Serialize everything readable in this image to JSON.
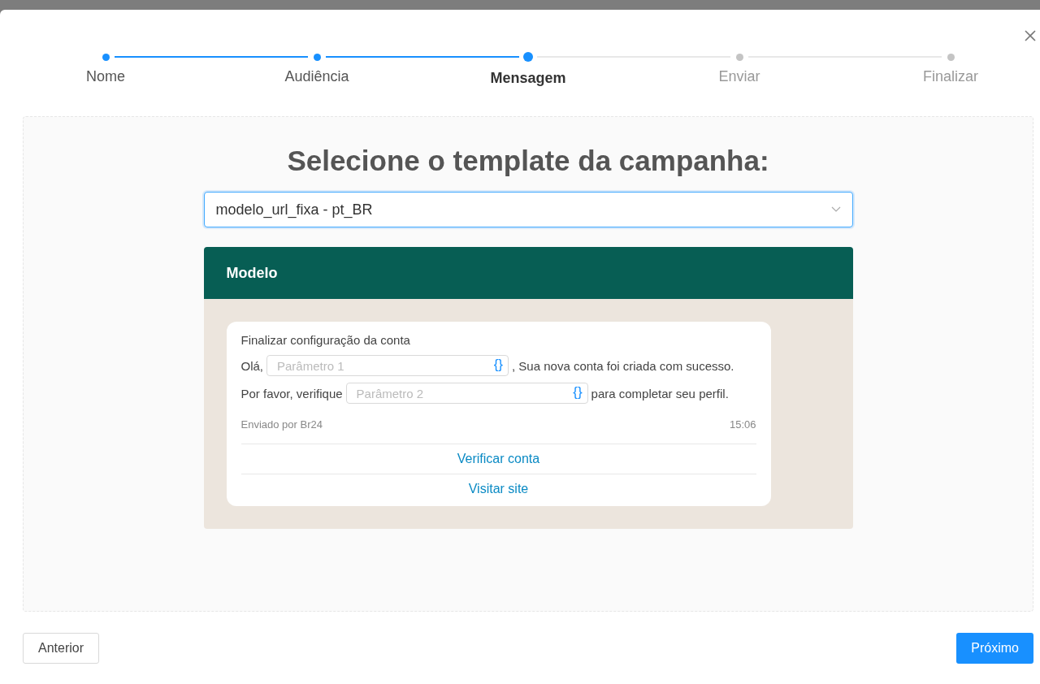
{
  "steps": [
    {
      "label": "Nome",
      "completed": true,
      "selected": false
    },
    {
      "label": "Audiência",
      "completed": true,
      "selected": false
    },
    {
      "label": "Mensagem",
      "completed": false,
      "selected": true
    },
    {
      "label": "Enviar",
      "completed": false,
      "selected": false
    },
    {
      "label": "Finalizar",
      "completed": false,
      "selected": false
    }
  ],
  "title": "Selecione o template da campanha:",
  "template_select": {
    "value": "modelo_url_fixa - pt_BR"
  },
  "preview": {
    "header": "Modelo",
    "message_title": "Finalizar configuração da conta",
    "lines": [
      [
        {
          "kind": "text",
          "text": "Olá,"
        },
        {
          "kind": "param",
          "placeholder": "Parâmetro 1",
          "icon": "{}"
        },
        {
          "kind": "text",
          "text": ", Sua nova conta foi criada com sucesso."
        }
      ],
      [
        {
          "kind": "text",
          "text": "Por favor, verifique"
        },
        {
          "kind": "param",
          "placeholder": "Parâmetro 2",
          "icon": "{}"
        },
        {
          "kind": "text",
          "text": "para completar seu perfil."
        }
      ]
    ],
    "sender": "Enviado por Br24",
    "time": "15:06",
    "buttons": [
      "Verificar conta",
      "Visitar site"
    ]
  },
  "footer": {
    "back": "Anterior",
    "next": "Próximo"
  }
}
